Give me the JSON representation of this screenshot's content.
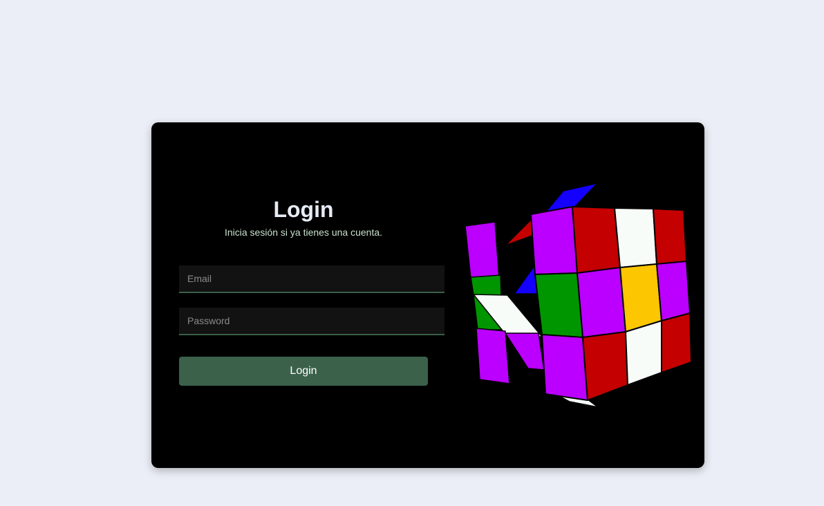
{
  "form": {
    "title": "Login",
    "subtitle": "Inicia sesión si ya tienes una cuenta.",
    "email_placeholder": "Email",
    "password_placeholder": "Password",
    "submit_label": "Login"
  },
  "colors": {
    "page_background": "#ebeef6",
    "card_background": "#000000",
    "accent": "#3b614a",
    "cube_purple": "#bb00ff",
    "cube_red": "#c40000",
    "cube_white": "#f7fcf8",
    "cube_green": "#009600",
    "cube_yellow": "#fcc600",
    "cube_blue": "#1400ff"
  }
}
